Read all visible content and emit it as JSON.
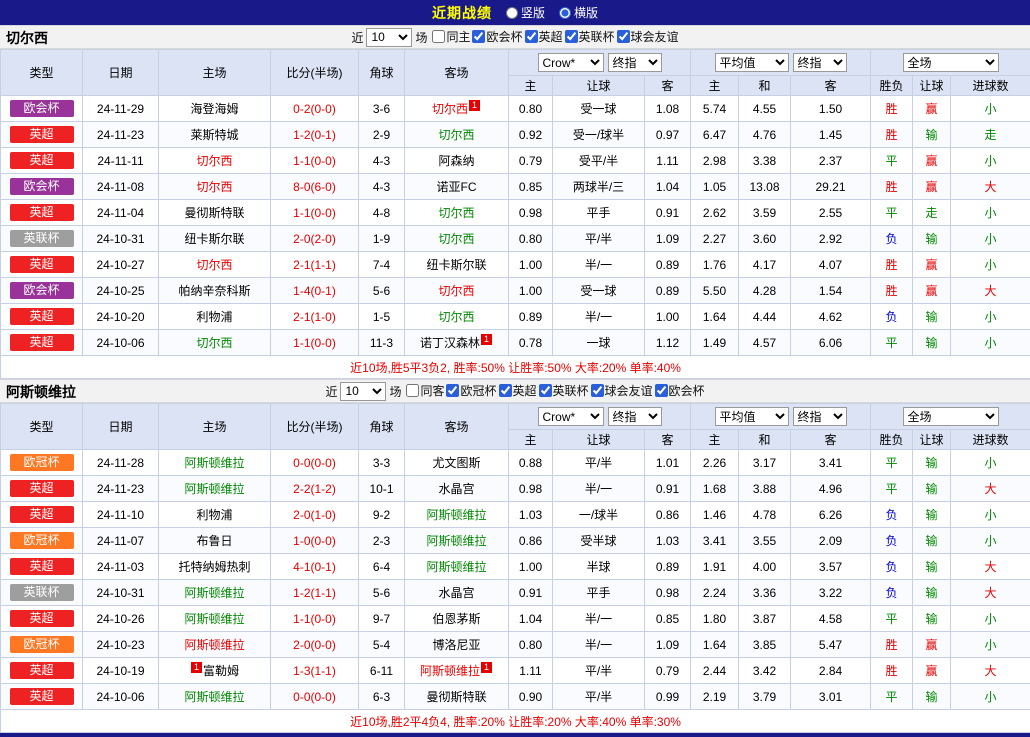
{
  "topbar": {
    "title": "近期战绩",
    "layout_options": [
      {
        "label": "竖版",
        "checked": false
      },
      {
        "label": "横版",
        "checked": true
      }
    ]
  },
  "table_config": {
    "col_headers": [
      "类型",
      "日期",
      "主场",
      "比分(半场)",
      "角球",
      "客场"
    ],
    "sub_headers": [
      "主",
      "让球",
      "客",
      "主",
      "和",
      "客",
      "胜负",
      "让球",
      "进球数"
    ],
    "selects": {
      "odds_source": "Crow*",
      "odds_source_type": "终指",
      "avg_source": "平均值",
      "avg_source_type": "终指",
      "scope": "全场"
    }
  },
  "league_colors": {
    "英超": "#ee2222",
    "欧会杯": "#993399",
    "英联杯": "#9e9e9e",
    "欧冠杯": "#ff7722"
  },
  "text_colors": {
    "r": "#e60000",
    "g": "#008800",
    "b": "#0000cc",
    "k": "#000000"
  },
  "sections": [
    {
      "team": "切尔西",
      "filter": {
        "near_label": "近",
        "matches": "10",
        "matches_label": "场",
        "checkboxes": [
          {
            "label": "同主",
            "checked": false
          },
          {
            "label": "欧会杯",
            "checked": true
          },
          {
            "label": "英超",
            "checked": true
          },
          {
            "label": "英联杯",
            "checked": true
          },
          {
            "label": "球会友谊",
            "checked": true
          }
        ]
      },
      "rows": [
        {
          "league": "欧会杯",
          "date": "24-11-29",
          "home": {
            "name": "海登海姆",
            "color": "k"
          },
          "score": "0-2(0-0)",
          "corner": "3-6",
          "away": {
            "name": "切尔西",
            "color": "r",
            "badge": "1",
            "badge_pos": "after"
          },
          "odds": [
            "0.80",
            "受一球",
            "1.08",
            "5.74",
            "4.55",
            "1.50"
          ],
          "res": [
            [
              "胜",
              "r"
            ],
            [
              "赢",
              "r"
            ],
            [
              "小",
              "g"
            ]
          ]
        },
        {
          "league": "英超",
          "date": "24-11-23",
          "home": {
            "name": "莱斯特城",
            "color": "k"
          },
          "score": "1-2(0-1)",
          "corner": "2-9",
          "away": {
            "name": "切尔西",
            "color": "g"
          },
          "odds": [
            "0.92",
            "受一/球半",
            "0.97",
            "6.47",
            "4.76",
            "1.45"
          ],
          "res": [
            [
              "胜",
              "r"
            ],
            [
              "输",
              "g"
            ],
            [
              "走",
              "g"
            ]
          ]
        },
        {
          "league": "英超",
          "date": "24-11-11",
          "home": {
            "name": "切尔西",
            "color": "r"
          },
          "score": "1-1(0-0)",
          "corner": "4-3",
          "away": {
            "name": "阿森纳",
            "color": "k"
          },
          "odds": [
            "0.79",
            "受平/半",
            "1.11",
            "2.98",
            "3.38",
            "2.37"
          ],
          "res": [
            [
              "平",
              "g"
            ],
            [
              "赢",
              "r"
            ],
            [
              "小",
              "g"
            ]
          ]
        },
        {
          "league": "欧会杯",
          "date": "24-11-08",
          "home": {
            "name": "切尔西",
            "color": "r"
          },
          "score": "8-0(6-0)",
          "corner": "4-3",
          "away": {
            "name": "诺亚FC",
            "color": "k"
          },
          "odds": [
            "0.85",
            "两球半/三",
            "1.04",
            "1.05",
            "13.08",
            "29.21"
          ],
          "res": [
            [
              "胜",
              "r"
            ],
            [
              "赢",
              "r"
            ],
            [
              "大",
              "r"
            ]
          ]
        },
        {
          "league": "英超",
          "date": "24-11-04",
          "home": {
            "name": "曼彻斯特联",
            "color": "k"
          },
          "score": "1-1(0-0)",
          "corner": "4-8",
          "away": {
            "name": "切尔西",
            "color": "g"
          },
          "odds": [
            "0.98",
            "平手",
            "0.91",
            "2.62",
            "3.59",
            "2.55"
          ],
          "res": [
            [
              "平",
              "g"
            ],
            [
              "走",
              "g"
            ],
            [
              "小",
              "g"
            ]
          ]
        },
        {
          "league": "英联杯",
          "date": "24-10-31",
          "home": {
            "name": "纽卡斯尔联",
            "color": "k"
          },
          "score": "2-0(2-0)",
          "corner": "1-9",
          "away": {
            "name": "切尔西",
            "color": "g"
          },
          "odds": [
            "0.80",
            "平/半",
            "1.09",
            "2.27",
            "3.60",
            "2.92"
          ],
          "res": [
            [
              "负",
              "b"
            ],
            [
              "输",
              "g"
            ],
            [
              "小",
              "g"
            ]
          ]
        },
        {
          "league": "英超",
          "date": "24-10-27",
          "home": {
            "name": "切尔西",
            "color": "r"
          },
          "score": "2-1(1-1)",
          "corner": "7-4",
          "away": {
            "name": "纽卡斯尔联",
            "color": "k"
          },
          "odds": [
            "1.00",
            "半/一",
            "0.89",
            "1.76",
            "4.17",
            "4.07"
          ],
          "res": [
            [
              "胜",
              "r"
            ],
            [
              "赢",
              "r"
            ],
            [
              "小",
              "g"
            ]
          ]
        },
        {
          "league": "欧会杯",
          "date": "24-10-25",
          "home": {
            "name": "帕纳辛奈科斯",
            "color": "k"
          },
          "score": "1-4(0-1)",
          "corner": "5-6",
          "away": {
            "name": "切尔西",
            "color": "r"
          },
          "odds": [
            "1.00",
            "受一球",
            "0.89",
            "5.50",
            "4.28",
            "1.54"
          ],
          "res": [
            [
              "胜",
              "r"
            ],
            [
              "赢",
              "r"
            ],
            [
              "大",
              "r"
            ]
          ]
        },
        {
          "league": "英超",
          "date": "24-10-20",
          "home": {
            "name": "利物浦",
            "color": "k"
          },
          "score": "2-1(1-0)",
          "corner": "1-5",
          "away": {
            "name": "切尔西",
            "color": "g"
          },
          "odds": [
            "0.89",
            "半/一",
            "1.00",
            "1.64",
            "4.44",
            "4.62"
          ],
          "res": [
            [
              "负",
              "b"
            ],
            [
              "输",
              "g"
            ],
            [
              "小",
              "g"
            ]
          ]
        },
        {
          "league": "英超",
          "date": "24-10-06",
          "home": {
            "name": "切尔西",
            "color": "g"
          },
          "score": "1-1(0-0)",
          "corner": "11-3",
          "away": {
            "name": "诺丁汉森林",
            "color": "k",
            "badge": "1",
            "badge_pos": "after"
          },
          "odds": [
            "0.78",
            "一球",
            "1.12",
            "1.49",
            "4.57",
            "6.06"
          ],
          "res": [
            [
              "平",
              "g"
            ],
            [
              "输",
              "g"
            ],
            [
              "小",
              "g"
            ]
          ]
        }
      ],
      "summary": "近10场,胜5平3负2, 胜率:50% 让胜率:50% 大率:20% 单率:40%"
    },
    {
      "team": "阿斯顿维拉",
      "filter": {
        "near_label": "近",
        "matches": "10",
        "matches_label": "场",
        "checkboxes": [
          {
            "label": "同客",
            "checked": false
          },
          {
            "label": "欧冠杯",
            "checked": true
          },
          {
            "label": "英超",
            "checked": true
          },
          {
            "label": "英联杯",
            "checked": true
          },
          {
            "label": "球会友谊",
            "checked": true
          },
          {
            "label": "欧会杯",
            "checked": true
          }
        ]
      },
      "rows": [
        {
          "league": "欧冠杯",
          "date": "24-11-28",
          "home": {
            "name": "阿斯顿维拉",
            "color": "g"
          },
          "score": "0-0(0-0)",
          "corner": "3-3",
          "away": {
            "name": "尤文图斯",
            "color": "k"
          },
          "odds": [
            "0.88",
            "平/半",
            "1.01",
            "2.26",
            "3.17",
            "3.41"
          ],
          "res": [
            [
              "平",
              "g"
            ],
            [
              "输",
              "g"
            ],
            [
              "小",
              "g"
            ]
          ]
        },
        {
          "league": "英超",
          "date": "24-11-23",
          "home": {
            "name": "阿斯顿维拉",
            "color": "g"
          },
          "score": "2-2(1-2)",
          "corner": "10-1",
          "away": {
            "name": "水晶宫",
            "color": "k"
          },
          "odds": [
            "0.98",
            "半/一",
            "0.91",
            "1.68",
            "3.88",
            "4.96"
          ],
          "res": [
            [
              "平",
              "g"
            ],
            [
              "输",
              "g"
            ],
            [
              "大",
              "r"
            ]
          ]
        },
        {
          "league": "英超",
          "date": "24-11-10",
          "home": {
            "name": "利物浦",
            "color": "k"
          },
          "score": "2-0(1-0)",
          "corner": "9-2",
          "away": {
            "name": "阿斯顿维拉",
            "color": "g"
          },
          "odds": [
            "1.03",
            "一/球半",
            "0.86",
            "1.46",
            "4.78",
            "6.26"
          ],
          "res": [
            [
              "负",
              "b"
            ],
            [
              "输",
              "g"
            ],
            [
              "小",
              "g"
            ]
          ]
        },
        {
          "league": "欧冠杯",
          "date": "24-11-07",
          "home": {
            "name": "布鲁日",
            "color": "k"
          },
          "score": "1-0(0-0)",
          "corner": "2-3",
          "away": {
            "name": "阿斯顿维拉",
            "color": "g"
          },
          "odds": [
            "0.86",
            "受半球",
            "1.03",
            "3.41",
            "3.55",
            "2.09"
          ],
          "res": [
            [
              "负",
              "b"
            ],
            [
              "输",
              "g"
            ],
            [
              "小",
              "g"
            ]
          ]
        },
        {
          "league": "英超",
          "date": "24-11-03",
          "home": {
            "name": "托特纳姆热刺",
            "color": "k"
          },
          "score": "4-1(0-1)",
          "corner": "6-4",
          "away": {
            "name": "阿斯顿维拉",
            "color": "g"
          },
          "odds": [
            "1.00",
            "半球",
            "0.89",
            "1.91",
            "4.00",
            "3.57"
          ],
          "res": [
            [
              "负",
              "b"
            ],
            [
              "输",
              "g"
            ],
            [
              "大",
              "r"
            ]
          ]
        },
        {
          "league": "英联杯",
          "date": "24-10-31",
          "home": {
            "name": "阿斯顿维拉",
            "color": "g"
          },
          "score": "1-2(1-1)",
          "corner": "5-6",
          "away": {
            "name": "水晶宫",
            "color": "k"
          },
          "odds": [
            "0.91",
            "平手",
            "0.98",
            "2.24",
            "3.36",
            "3.22"
          ],
          "res": [
            [
              "负",
              "b"
            ],
            [
              "输",
              "g"
            ],
            [
              "大",
              "r"
            ]
          ]
        },
        {
          "league": "英超",
          "date": "24-10-26",
          "home": {
            "name": "阿斯顿维拉",
            "color": "g"
          },
          "score": "1-1(0-0)",
          "corner": "9-7",
          "away": {
            "name": "伯恩茅斯",
            "color": "k"
          },
          "odds": [
            "1.04",
            "半/一",
            "0.85",
            "1.80",
            "3.87",
            "4.58"
          ],
          "res": [
            [
              "平",
              "g"
            ],
            [
              "输",
              "g"
            ],
            [
              "小",
              "g"
            ]
          ]
        },
        {
          "league": "欧冠杯",
          "date": "24-10-23",
          "home": {
            "name": "阿斯顿维拉",
            "color": "r"
          },
          "score": "2-0(0-0)",
          "corner": "5-4",
          "away": {
            "name": "博洛尼亚",
            "color": "k"
          },
          "odds": [
            "0.80",
            "半/一",
            "1.09",
            "1.64",
            "3.85",
            "5.47"
          ],
          "res": [
            [
              "胜",
              "r"
            ],
            [
              "赢",
              "r"
            ],
            [
              "小",
              "g"
            ]
          ]
        },
        {
          "league": "英超",
          "date": "24-10-19",
          "home": {
            "name": "富勒姆",
            "color": "k",
            "badge": "1",
            "badge_pos": "before"
          },
          "score": "1-3(1-1)",
          "corner": "6-11",
          "away": {
            "name": "阿斯顿维拉",
            "color": "r",
            "badge": "1",
            "badge_pos": "after"
          },
          "odds": [
            "1.11",
            "平/半",
            "0.79",
            "2.44",
            "3.42",
            "2.84"
          ],
          "res": [
            [
              "胜",
              "r"
            ],
            [
              "赢",
              "r"
            ],
            [
              "大",
              "r"
            ]
          ]
        },
        {
          "league": "英超",
          "date": "24-10-06",
          "home": {
            "name": "阿斯顿维拉",
            "color": "g"
          },
          "score": "0-0(0-0)",
          "corner": "6-3",
          "away": {
            "name": "曼彻斯特联",
            "color": "k"
          },
          "odds": [
            "0.90",
            "平/半",
            "0.99",
            "2.19",
            "3.79",
            "3.01"
          ],
          "res": [
            [
              "平",
              "g"
            ],
            [
              "输",
              "g"
            ],
            [
              "小",
              "g"
            ]
          ]
        }
      ],
      "summary": "近10场,胜2平4负4, 胜率:20% 让胜率:20% 大率:40% 单率:30%"
    }
  ]
}
